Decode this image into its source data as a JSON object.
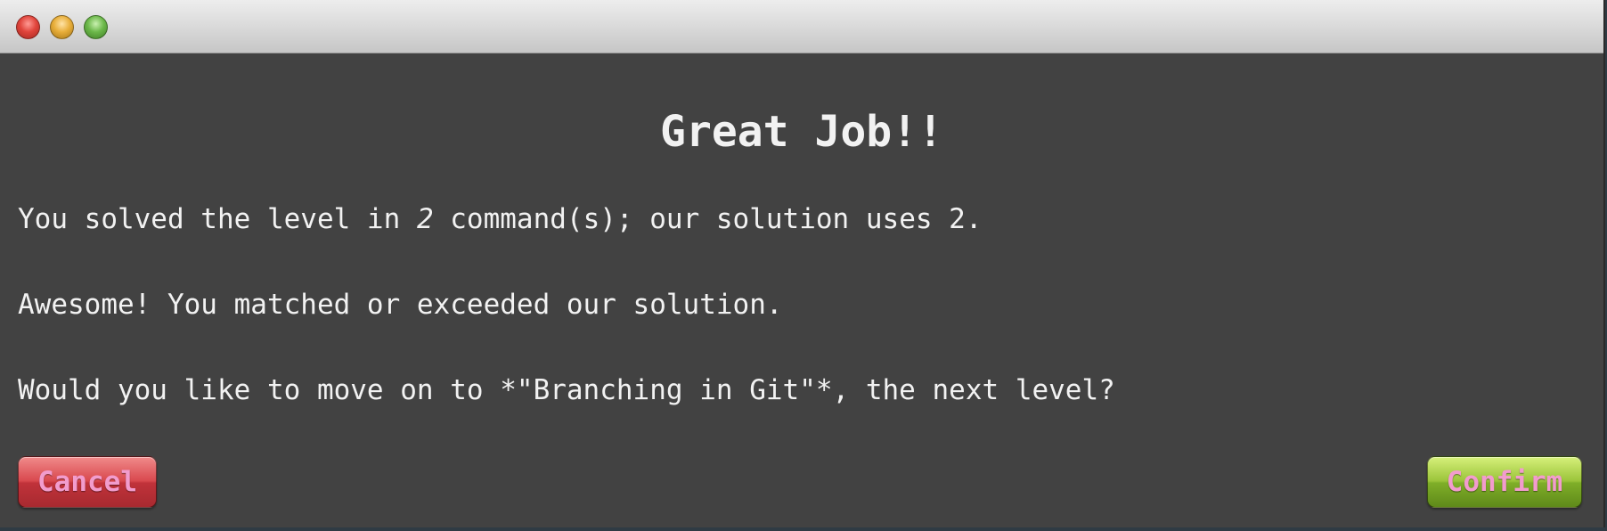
{
  "window": {
    "controls": [
      {
        "name": "close",
        "icon": "close-icon",
        "color": "#e0443b"
      },
      {
        "name": "minimize",
        "icon": "minimize-icon",
        "color": "#e8ae3a"
      },
      {
        "name": "zoom",
        "icon": "zoom-icon",
        "color": "#6cb84a"
      }
    ]
  },
  "dialog": {
    "title": "Great Job!!",
    "line1": {
      "before": "You solved the level in ",
      "count": "2",
      "after": " command(s); our solution uses 2."
    },
    "line2": "Awesome! You matched or exceeded our solution.",
    "line3": "Would you like to move on to *\"Branching in Git\"*, the next level?"
  },
  "buttons": {
    "cancel_label": "Cancel",
    "confirm_label": "Confirm"
  },
  "colors": {
    "background": "#424242",
    "text": "#f2f2f2",
    "button_text": "#f29ccd",
    "cancel": "#c0323a",
    "confirm": "#7fae28"
  }
}
